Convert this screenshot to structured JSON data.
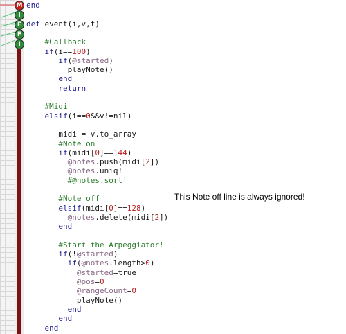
{
  "pins": [
    {
      "label": "M",
      "kind": "m"
    },
    {
      "label": "I",
      "kind": "g"
    },
    {
      "label": "F",
      "kind": "g"
    },
    {
      "label": "F",
      "kind": "g"
    },
    {
      "label": "I",
      "kind": "g"
    }
  ],
  "code_lines": [
    [
      {
        "t": "end",
        "c": "kw"
      }
    ],
    [],
    [
      {
        "t": "def",
        "c": "kw"
      },
      {
        "t": " event(i,v,t)",
        "c": "tx"
      }
    ],
    [],
    [
      {
        "t": "    #Callback",
        "c": "cm"
      }
    ],
    [
      {
        "t": "    if",
        "c": "kw"
      },
      {
        "t": "(i==",
        "c": "tx"
      },
      {
        "t": "100",
        "c": "nm"
      },
      {
        "t": ")",
        "c": "tx"
      }
    ],
    [
      {
        "t": "       if",
        "c": "kw"
      },
      {
        "t": "(",
        "c": "tx"
      },
      {
        "t": "@started",
        "c": "iv"
      },
      {
        "t": ")",
        "c": "tx"
      }
    ],
    [
      {
        "t": "         playNote()",
        "c": "tx"
      }
    ],
    [
      {
        "t": "       end",
        "c": "kw"
      }
    ],
    [
      {
        "t": "       return",
        "c": "kw"
      }
    ],
    [],
    [
      {
        "t": "    #Midi",
        "c": "cm"
      }
    ],
    [
      {
        "t": "    elsif",
        "c": "kw"
      },
      {
        "t": "(i==",
        "c": "tx"
      },
      {
        "t": "0",
        "c": "nm"
      },
      {
        "t": "&&v!=nil)",
        "c": "tx"
      }
    ],
    [],
    [
      {
        "t": "       midi = v.to_array",
        "c": "tx"
      }
    ],
    [
      {
        "t": "       #Note on",
        "c": "cm"
      }
    ],
    [
      {
        "t": "       if",
        "c": "kw"
      },
      {
        "t": "(midi[",
        "c": "tx"
      },
      {
        "t": "0",
        "c": "nm"
      },
      {
        "t": "]==",
        "c": "tx"
      },
      {
        "t": "144",
        "c": "nm"
      },
      {
        "t": ")",
        "c": "tx"
      }
    ],
    [
      {
        "t": "         @notes",
        "c": "iv"
      },
      {
        "t": ".push(midi[",
        "c": "tx"
      },
      {
        "t": "2",
        "c": "nm"
      },
      {
        "t": "])",
        "c": "tx"
      }
    ],
    [
      {
        "t": "         @notes",
        "c": "iv"
      },
      {
        "t": ".uniq!",
        "c": "tx"
      }
    ],
    [
      {
        "t": "         #@notes.sort!",
        "c": "cm"
      }
    ],
    [],
    [
      {
        "t": "       #Note off",
        "c": "cm"
      }
    ],
    [
      {
        "t": "       elsif",
        "c": "kw"
      },
      {
        "t": "(midi[",
        "c": "tx"
      },
      {
        "t": "0",
        "c": "nm"
      },
      {
        "t": "]==",
        "c": "tx"
      },
      {
        "t": "128",
        "c": "nm"
      },
      {
        "t": ")",
        "c": "tx"
      }
    ],
    [
      {
        "t": "         @notes",
        "c": "iv"
      },
      {
        "t": ".delete(midi[",
        "c": "tx"
      },
      {
        "t": "2",
        "c": "nm"
      },
      {
        "t": "])",
        "c": "tx"
      }
    ],
    [
      {
        "t": "       end",
        "c": "kw"
      }
    ],
    [],
    [
      {
        "t": "       #Start the Arpeggiator!",
        "c": "cm"
      }
    ],
    [
      {
        "t": "       if",
        "c": "kw"
      },
      {
        "t": "(!",
        "c": "tx"
      },
      {
        "t": "@started",
        "c": "iv"
      },
      {
        "t": ")",
        "c": "tx"
      }
    ],
    [
      {
        "t": "         if",
        "c": "kw"
      },
      {
        "t": "(",
        "c": "tx"
      },
      {
        "t": "@notes",
        "c": "iv"
      },
      {
        "t": ".length>",
        "c": "tx"
      },
      {
        "t": "0",
        "c": "nm"
      },
      {
        "t": ")",
        "c": "tx"
      }
    ],
    [
      {
        "t": "           @started",
        "c": "iv"
      },
      {
        "t": "=true",
        "c": "tx"
      }
    ],
    [
      {
        "t": "           @pos",
        "c": "iv"
      },
      {
        "t": "=",
        "c": "tx"
      },
      {
        "t": "0",
        "c": "nm"
      }
    ],
    [
      {
        "t": "           @rangeCount",
        "c": "iv"
      },
      {
        "t": "=",
        "c": "tx"
      },
      {
        "t": "0",
        "c": "nm"
      }
    ],
    [
      {
        "t": "           playNote()",
        "c": "tx"
      }
    ],
    [
      {
        "t": "         end",
        "c": "kw"
      }
    ],
    [
      {
        "t": "       end",
        "c": "kw"
      }
    ],
    [
      {
        "t": "    end",
        "c": "kw"
      }
    ]
  ],
  "annotation": "This Note off line is always ignored!",
  "colors": {
    "keyword": "#1f1f8f",
    "comment": "#2e7d2e",
    "ivar": "#8a6a88",
    "number": "#b62020",
    "text": "#1a1a1a",
    "pin_m": "#c0241e",
    "pin_g": "#2f8a3a",
    "gutter_bar": "#7a1212"
  }
}
